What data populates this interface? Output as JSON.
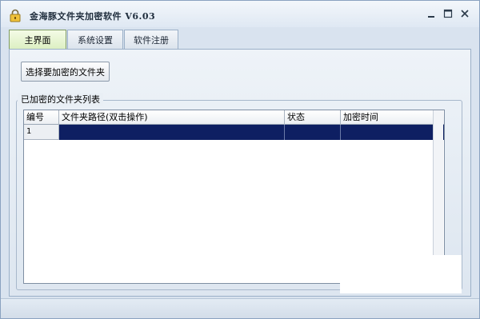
{
  "window": {
    "title": "金海豚文件夹加密软件 V6.03",
    "icon": "lock-icon",
    "controls": [
      "minimize-icon",
      "maximize-icon",
      "close-icon"
    ]
  },
  "tabs": [
    {
      "label": "主界面",
      "active": true
    },
    {
      "label": "系统设置",
      "active": false
    },
    {
      "label": "软件注册",
      "active": false
    }
  ],
  "main": {
    "select_button_label": "选择要加密的文件夹",
    "group_title": "已加密的文件夹列表",
    "table": {
      "columns": [
        "编号",
        "文件夹路径(双击操作)",
        "状态",
        "加密时间"
      ],
      "rows": [
        {
          "index": "1",
          "path": "",
          "status": "",
          "time": "",
          "selected": true
        }
      ]
    }
  },
  "colors": {
    "selected_row": "#0e1f62",
    "active_tab": "#dcefc1",
    "window_bg": "#d9e3ef"
  }
}
